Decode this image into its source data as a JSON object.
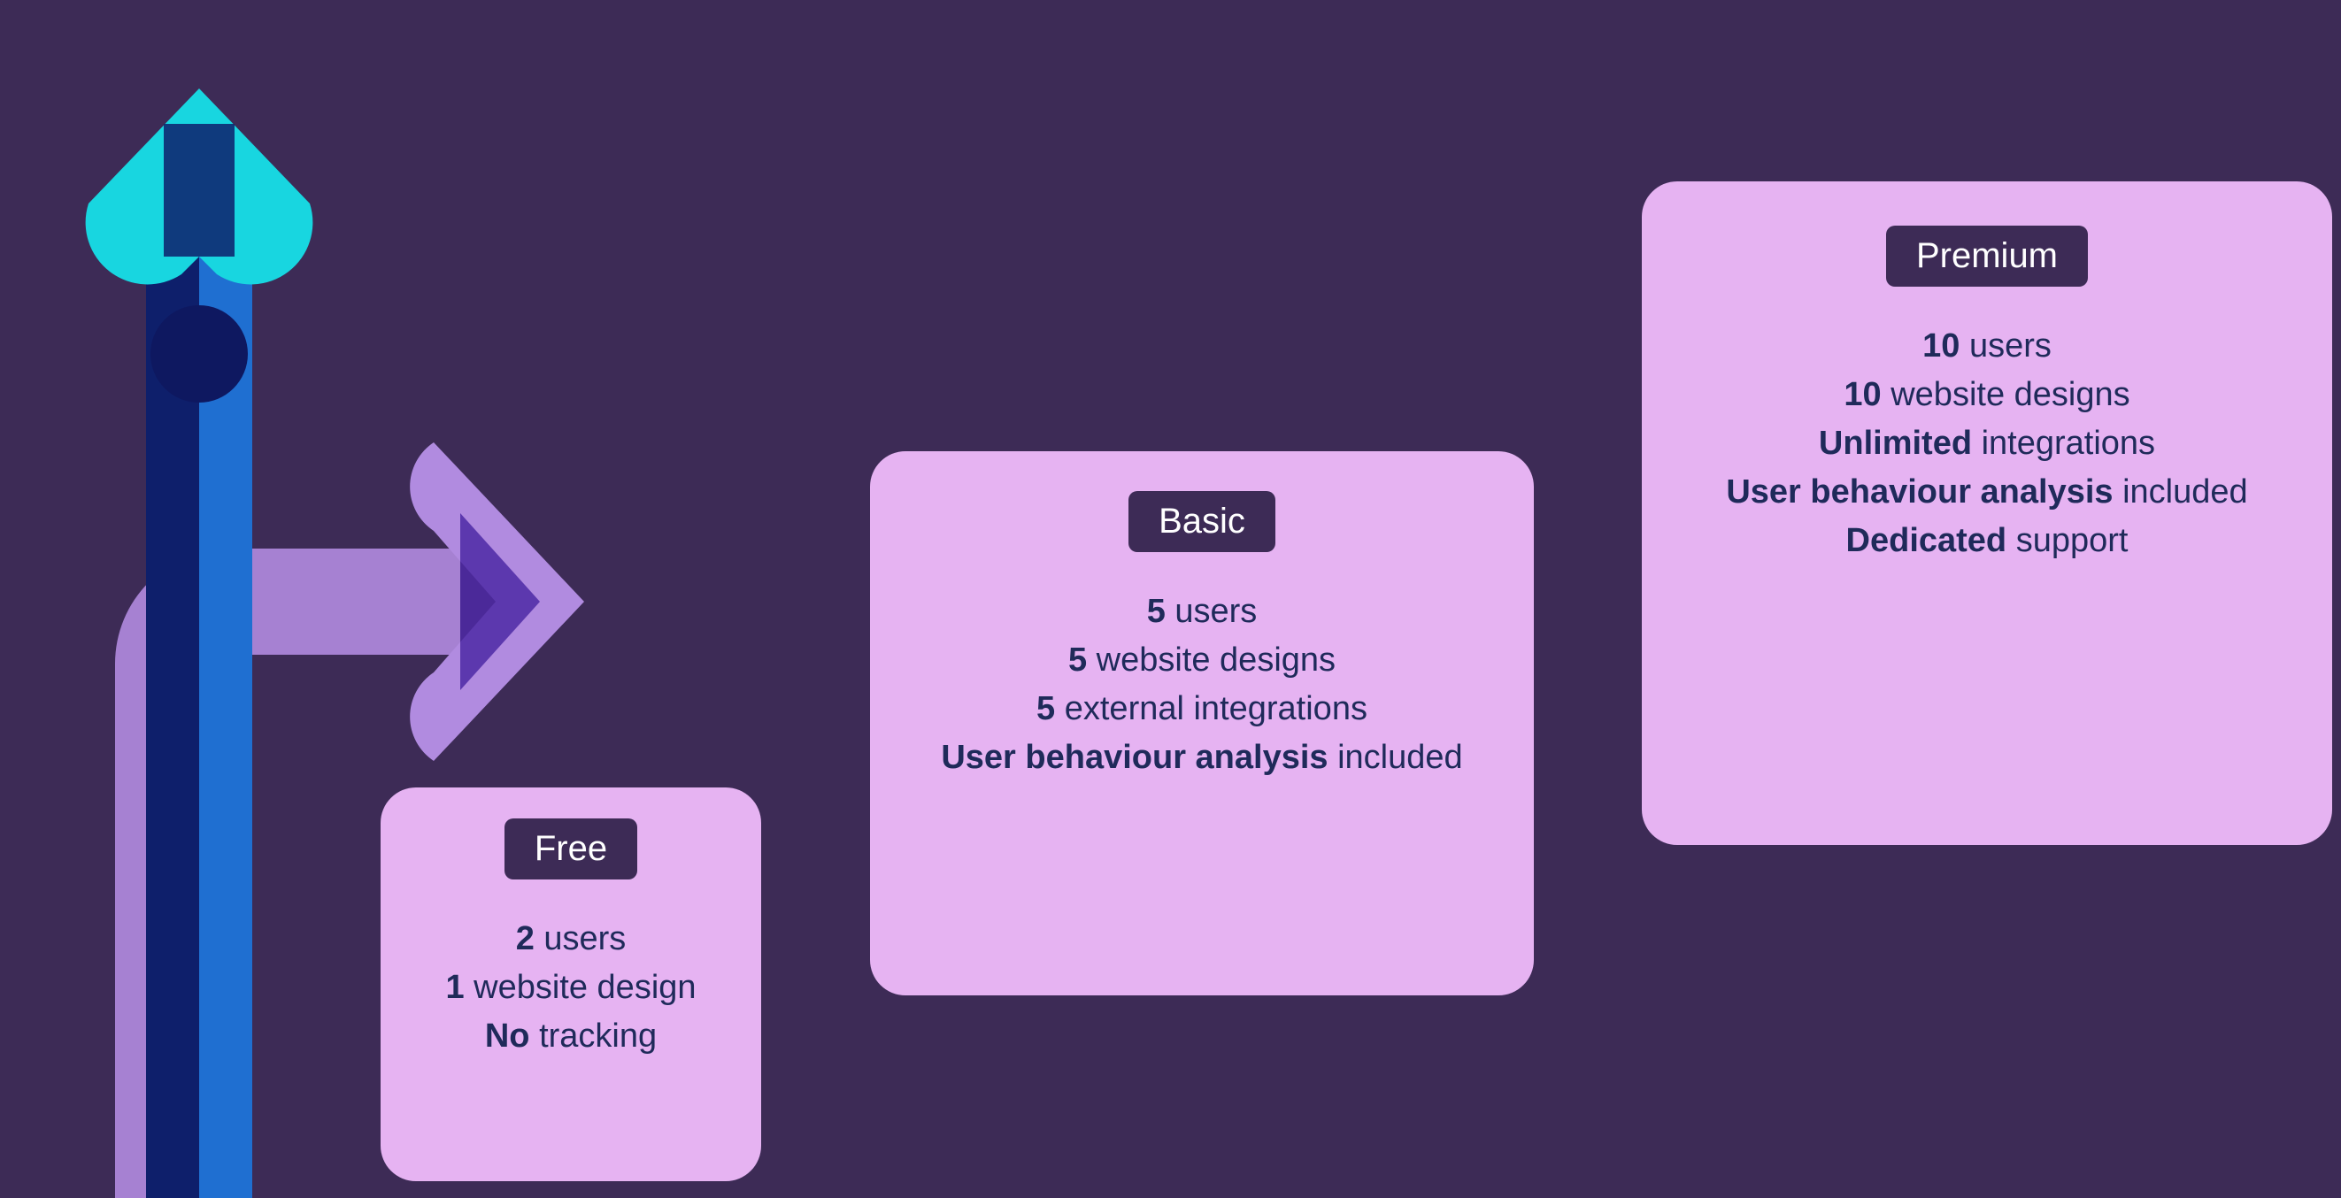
{
  "tiers": {
    "free": {
      "label": "Free",
      "features": [
        {
          "bold": "2",
          "rest": " users"
        },
        {
          "bold": "1",
          "rest": " website design"
        },
        {
          "bold": "No",
          "rest": " tracking"
        }
      ]
    },
    "basic": {
      "label": "Basic",
      "features": [
        {
          "bold": "5",
          "rest": " users"
        },
        {
          "bold": "5",
          "rest": " website designs"
        },
        {
          "bold": "5",
          "rest": " external integrations"
        },
        {
          "bold": "User behaviour analysis",
          "rest": " included"
        }
      ]
    },
    "premium": {
      "label": "Premium",
      "features": [
        {
          "bold": "10",
          "rest": " users"
        },
        {
          "bold": "10",
          "rest": " website designs"
        },
        {
          "bold": "Unlimited",
          "rest": " integrations"
        },
        {
          "bold": "User behaviour analysis",
          "rest": " included"
        },
        {
          "bold": "Dedicated",
          "rest": " support"
        }
      ]
    }
  },
  "colors": {
    "background": "#3d2b56",
    "card": "#e6b3f2",
    "text": "#1f2a5a",
    "labelBg": "#3d2b56",
    "labelText": "#ffffff",
    "arrowUpHead": "#18d6e0",
    "arrowUpShaftDark": "#0e1f6b",
    "arrowUpShaftLight": "#1f6fd1",
    "arrowRight": "#b18be0",
    "arrowRightHeadDark": "#4e29a5"
  }
}
